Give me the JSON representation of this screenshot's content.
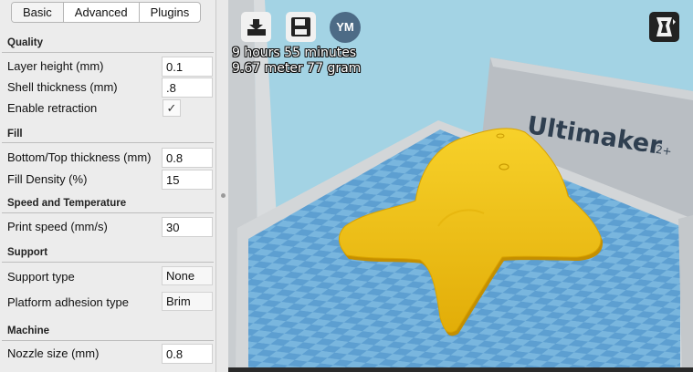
{
  "tabs": [
    {
      "label": "Basic",
      "active": true
    },
    {
      "label": "Advanced",
      "active": false
    },
    {
      "label": "Plugins",
      "active": false
    }
  ],
  "sections": {
    "quality": "Quality",
    "fill": "Fill",
    "speed": "Speed and Temperature",
    "support": "Support",
    "machine": "Machine"
  },
  "settings": {
    "layer_height": {
      "label": "Layer height (mm)",
      "value": "0.1"
    },
    "shell_thickness": {
      "label": "Shell thickness (mm)",
      "value": ".8"
    },
    "enable_retraction": {
      "label": "Enable retraction",
      "checked": true,
      "mark": "✓"
    },
    "bottom_top_thickness": {
      "label": "Bottom/Top thickness (mm)",
      "value": "0.8"
    },
    "fill_density": {
      "label": "Fill Density (%)",
      "value": "15"
    },
    "print_speed": {
      "label": "Print speed (mm/s)",
      "value": "30"
    },
    "support_type": {
      "label": "Support type",
      "value": "None"
    },
    "platform_adhesion": {
      "label": "Platform adhesion type",
      "value": "Brim"
    },
    "nozzle_size": {
      "label": "Nozzle size (mm)",
      "value": "0.8"
    }
  },
  "viewport": {
    "print_time": "9 hours 55 minutes",
    "material": "9.67 meter 77 gram",
    "user_badge": "YM",
    "printer_brand": "Ultimaker",
    "printer_model": "2+",
    "model_color": "#f2c41b",
    "toolbar_icons": [
      "load-model-icon",
      "save-icon",
      "user-avatar",
      "view-mode-icon"
    ]
  }
}
